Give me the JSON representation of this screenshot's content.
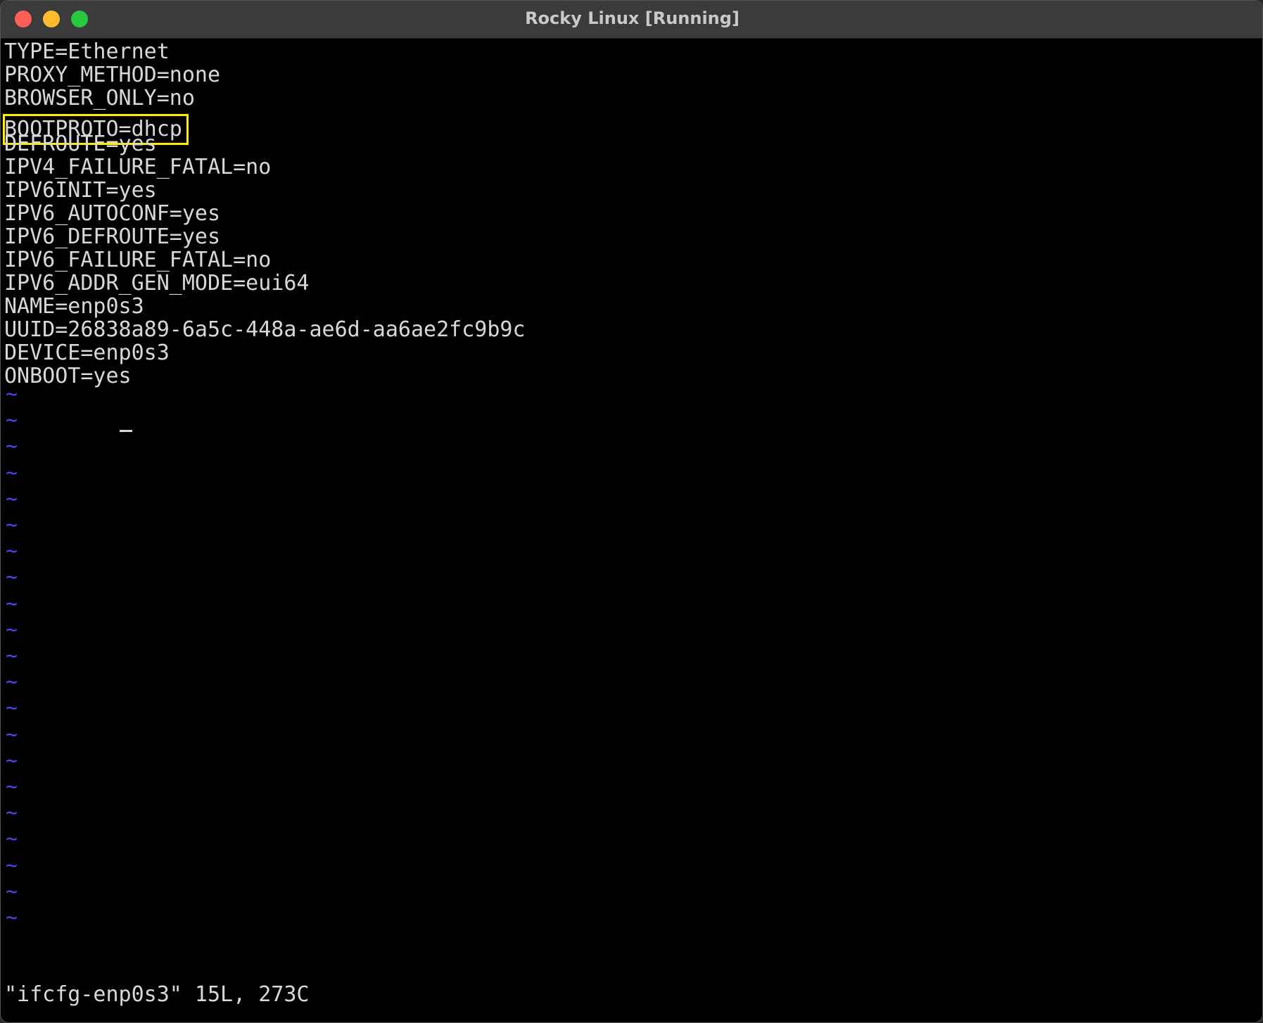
{
  "window": {
    "title": "Rocky Linux [Running]"
  },
  "editor": {
    "lines": [
      "TYPE=Ethernet",
      "PROXY_METHOD=none",
      "BROWSER_ONLY=no",
      "BOOTPROTO=dhcp",
      "DEFROUTE=yes",
      "IPV4_FAILURE_FATAL=no",
      "IPV6INIT=yes",
      "IPV6_AUTOCONF=yes",
      "IPV6_DEFROUTE=yes",
      "IPV6_FAILURE_FATAL=no",
      "IPV6_ADDR_GEN_MODE=eui64",
      "NAME=enp0s3",
      "UUID=26838a89-6a5c-448a-ae6d-aa6ae2fc9b9c",
      "DEVICE=enp0s3",
      "ONBOOT=yes"
    ],
    "empty_line_marker": "~",
    "status_line": "\"ifcfg-enp0s3\" 15L, 273C"
  },
  "colors": {
    "text": "#d8d8d8",
    "tilde": "#4a4aff",
    "highlight_box": "#ffea00",
    "background": "#000000"
  }
}
